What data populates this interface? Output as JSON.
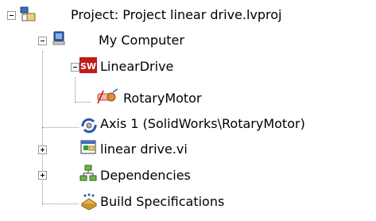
{
  "tree": {
    "project": {
      "label": "Project: Project linear drive.lvproj",
      "icon": "project-icon",
      "expanded": true
    },
    "computer": {
      "label": "My Computer",
      "icon": "computer-icon",
      "expanded": true
    },
    "lineardrive": {
      "label": "LinearDrive",
      "icon": "solidworks-icon",
      "expanded": true
    },
    "rotarymotor": {
      "label": "RotaryMotor",
      "icon": "motor-icon"
    },
    "axis": {
      "label": "Axis 1 (SolidWorks\\RotaryMotor)",
      "icon": "axis-icon"
    },
    "vi": {
      "label": "linear drive.vi",
      "icon": "vi-icon",
      "expanded": false
    },
    "dependencies": {
      "label": "Dependencies",
      "icon": "dependencies-icon",
      "expanded": false
    },
    "build": {
      "label": "Build Specifications",
      "icon": "build-icon"
    }
  }
}
